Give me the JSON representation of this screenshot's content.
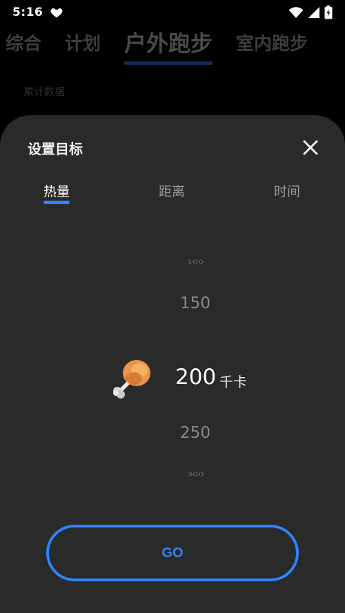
{
  "status_bar": {
    "time": "5:16"
  },
  "background": {
    "tabs": [
      "综合",
      "计划",
      "户外跑步",
      "室内跑步"
    ],
    "active_tab": "户外跑步",
    "subtitle": "累计数据"
  },
  "sheet": {
    "title": "设置目标",
    "tabs": [
      {
        "label": "热量",
        "active": true
      },
      {
        "label": "距离",
        "active": false
      },
      {
        "label": "时间",
        "active": false
      }
    ],
    "picker": {
      "values": [
        "100",
        "150",
        "200",
        "250",
        "300"
      ],
      "selected": "200",
      "unit": "千卡",
      "icon": "drumstick-icon"
    },
    "go_label": "GO"
  },
  "colors": {
    "accent": "#2f84ff",
    "sheet_bg": "#2a2a2a"
  }
}
